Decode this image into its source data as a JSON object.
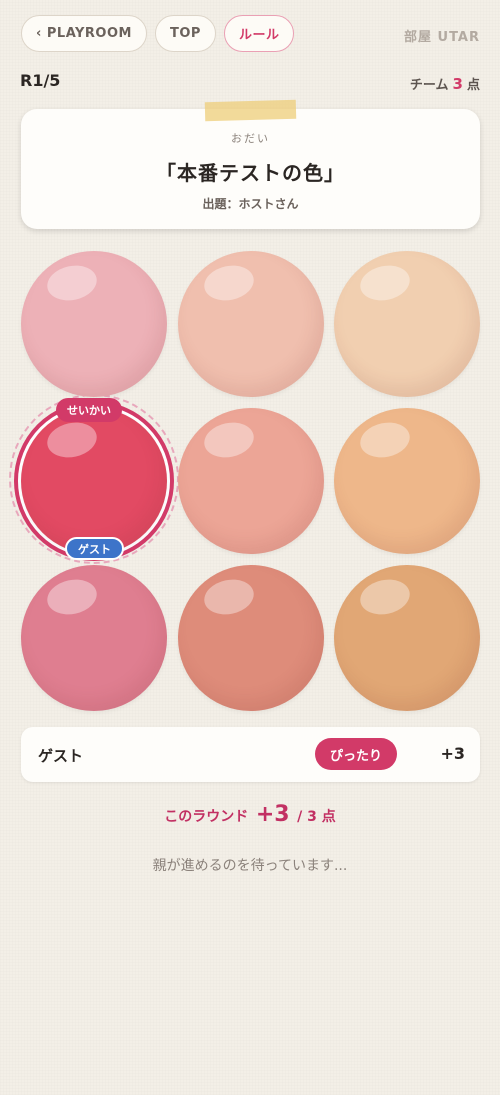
{
  "nav": {
    "back_label": "‹ PLAYROOM",
    "top_label": "TOP",
    "rule_label": "ルール",
    "room_label": "部屋 UTAR"
  },
  "round": {
    "label": "R1/5"
  },
  "team": {
    "prefix": "チーム",
    "score": "3",
    "suffix": "点"
  },
  "theme": {
    "label": "おだい",
    "title": "「本番テストの色」",
    "setter": "出題：ホストさん"
  },
  "colors": {
    "accent": "#d23a68",
    "guest": "#3d74c9",
    "swatches": [
      "#edb1b7",
      "#f0bfae",
      "#f1cfb0",
      "#e24a63",
      "#eca596",
      "#eeb78a",
      "#df7e90",
      "#de8c7a",
      "#e1a775"
    ]
  },
  "grid": {
    "correct_badge": "せいかい",
    "guest_badge": "ゲスト"
  },
  "result": {
    "name": "ゲスト",
    "badge": "ぴったり",
    "score": "+3"
  },
  "round_score": {
    "label": "このラウンド",
    "points": "+3",
    "total": "/ 3 点"
  },
  "status": "親が進めるのを待っています..."
}
